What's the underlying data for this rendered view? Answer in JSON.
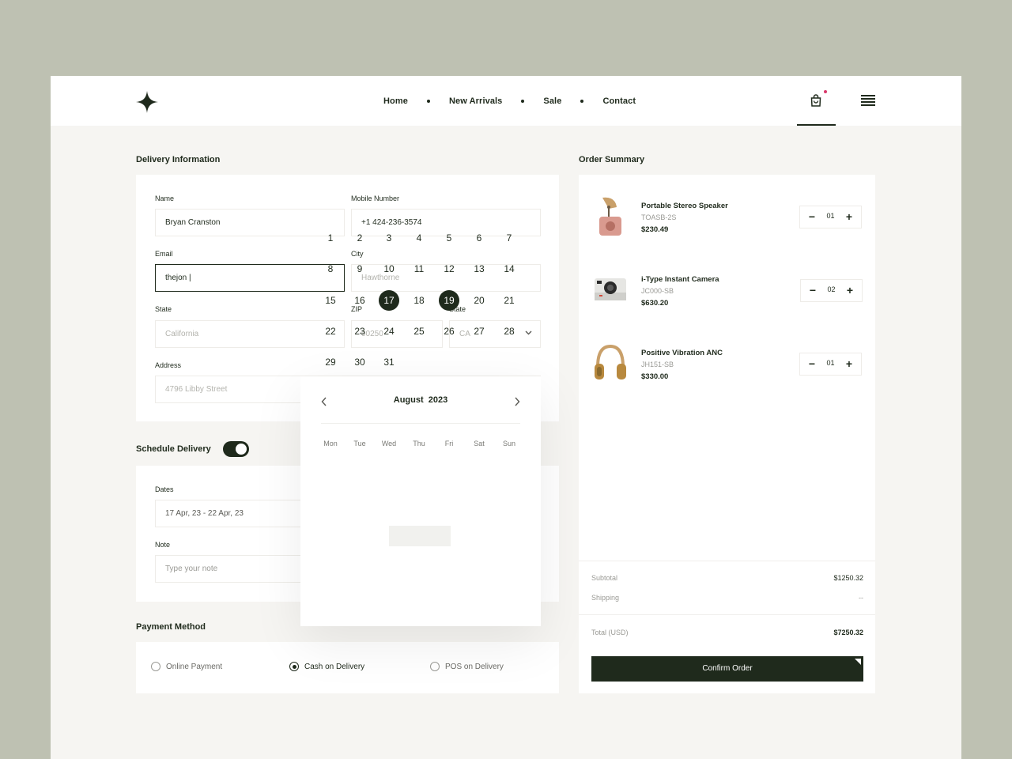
{
  "nav": {
    "items": [
      "Home",
      "New Arrivals",
      "Sale",
      "Contact"
    ]
  },
  "delivery": {
    "title": "Delivery Information",
    "name_label": "Name",
    "name_value": "Bryan Cranston",
    "mobile_label": "Mobile Number",
    "mobile_value": "+1 424-236-3574",
    "email_label": "Email",
    "email_value": "thejon |",
    "city_label": "City",
    "city_placeholder": "Hawthorne",
    "state_label": "State",
    "state_placeholder": "California",
    "zip_label": "ZIP",
    "zip_placeholder": "90250",
    "state2_label": "State",
    "state2_value": "CA",
    "address_label": "Address",
    "address_placeholder": "4796 Libby Street"
  },
  "schedule": {
    "title": "Schedule Delivery",
    "dates_label": "Dates",
    "dates_value": "17 Apr, 23 - 22 Apr, 23",
    "note_label": "Note",
    "note_placeholder": "Type your note"
  },
  "payment": {
    "title": "Payment Method",
    "options": [
      "Online Payment",
      "Cash on Delivery",
      "POS on Delivery"
    ],
    "selected": "Cash on Delivery"
  },
  "calendar": {
    "month": "August",
    "year": "2023",
    "weekdays": [
      "Mon",
      "Tue",
      "Wed",
      "Thu",
      "Fri",
      "Sat",
      "Sun"
    ],
    "days": [
      [
        "1",
        "2",
        "3",
        "4",
        "5",
        "6",
        "7"
      ],
      [
        "8",
        "9",
        "10",
        "11",
        "12",
        "13",
        "14"
      ],
      [
        "15",
        "16",
        "17",
        "18",
        "19",
        "20",
        "21"
      ],
      [
        "22",
        "23",
        "24",
        "25",
        "26",
        "27",
        "28"
      ],
      [
        "29",
        "30",
        "31"
      ]
    ],
    "range_start": "17",
    "range_end": "19"
  },
  "summary": {
    "title": "Order Summary",
    "items": [
      {
        "name": "Portable Stereo Speaker",
        "sku": "TOASB-2S",
        "price": "$230.49",
        "qty": "01"
      },
      {
        "name": "i-Type Instant Camera",
        "sku": "JC000-SB",
        "price": "$630.20",
        "qty": "02"
      },
      {
        "name": "Positive Vibration ANC",
        "sku": "JH151-SB",
        "price": "$330.00",
        "qty": "01"
      }
    ],
    "subtotal_label": "Subtotal",
    "subtotal_value": "$1250.32",
    "shipping_label": "Shipping",
    "shipping_value": "--",
    "total_label": "Total (USD)",
    "total_value": "$7250.32",
    "confirm_label": "Confirm Order"
  },
  "colors": {
    "accent": "#1f2a1c",
    "page_bg": "#bec1b2",
    "frame_bg": "#f6f5f2",
    "badge": "#d9396b"
  }
}
